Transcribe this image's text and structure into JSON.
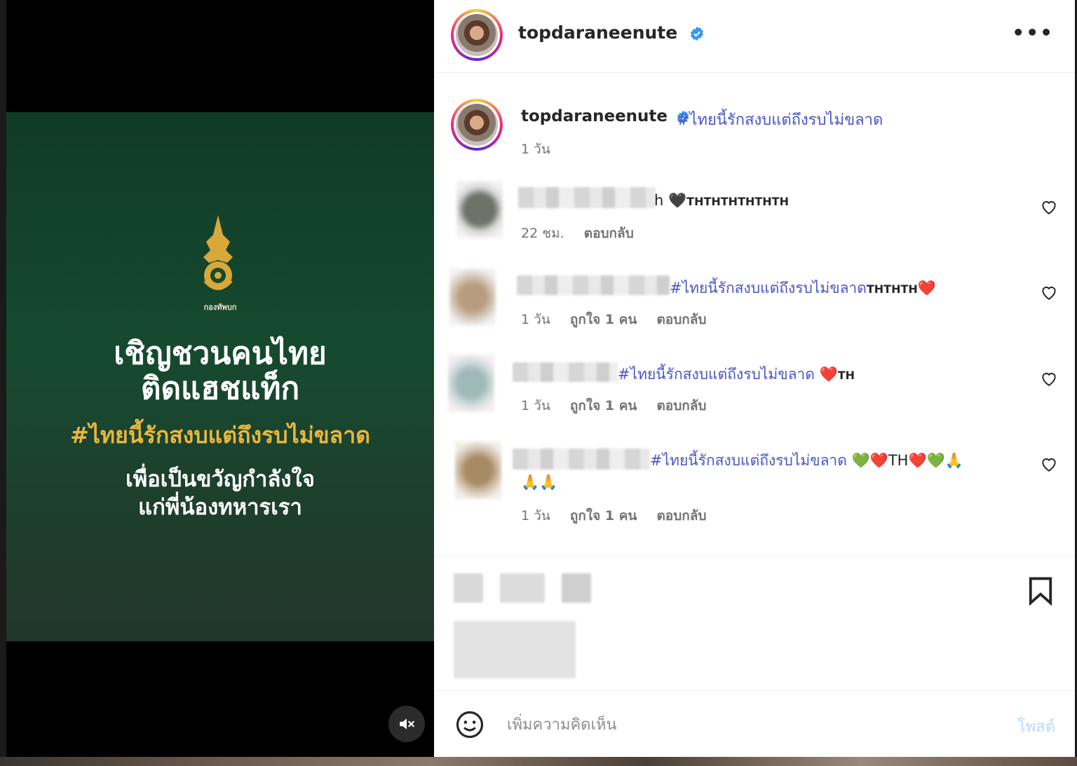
{
  "media": {
    "org_name": "กองทัพบก",
    "headline_line1": "เชิญชวนคนไทย",
    "headline_line2": "ติดแฮชแท็ก",
    "hashtag": "#ไทยนี้รักสงบแต่ถึงรบไม่ขลาด",
    "sub_line1": "เพื่อเป็นขวัญกำลังใจ",
    "sub_line2": "แก่พี่น้องทหารเรา",
    "mute_icon": "speaker-muted-icon"
  },
  "header": {
    "username": "topdaraneenute",
    "more_label": "•••"
  },
  "caption": {
    "username": "topdaraneenute",
    "text": "#ไทยนี้รักสงบแต่ถึงรบไม่ขลาด",
    "time": "1 วัน"
  },
  "comments": [
    {
      "prefix": "h",
      "tag": "",
      "suffix": "THTHTHTHTHTH",
      "emoji": "🖤",
      "time": "22 ชม.",
      "likes": "",
      "reply": "ตอบกลับ"
    },
    {
      "prefix": "",
      "tag": "#ไทยนี้รักสงบแต่ถึงรบไม่ขลาด",
      "suffix": "THTHTH",
      "emoji": "❤️",
      "time": "1 วัน",
      "likes": "ถูกใจ 1 คน",
      "reply": "ตอบกลับ"
    },
    {
      "prefix": "",
      "tag": "#ไทยนี้รักสงบแต่ถึงรบไม่ขลาด",
      "suffix": "TH",
      "emoji": "❤️",
      "time": "1 วัน",
      "likes": "ถูกใจ 1 คน",
      "reply": "ตอบกลับ"
    },
    {
      "prefix": "",
      "tag": "#ไทยนี้รักสงบแต่ถึงรบไม่ขลาด",
      "emoji_line1": "💚❤️TH❤️💚🙏",
      "emoji_line2": "🙏🙏",
      "time": "1 วัน",
      "likes": "ถูกใจ 1 คน",
      "reply": "ตอบกลับ"
    }
  ],
  "comment_box": {
    "placeholder": "เพิ่มความคิดเห็น",
    "post_label": "โพสต์"
  },
  "colors": {
    "link": "#4a56c7",
    "verified": "#3897f0",
    "hashtag_gold": "#e9b640",
    "post_disabled": "#b3dbff"
  }
}
